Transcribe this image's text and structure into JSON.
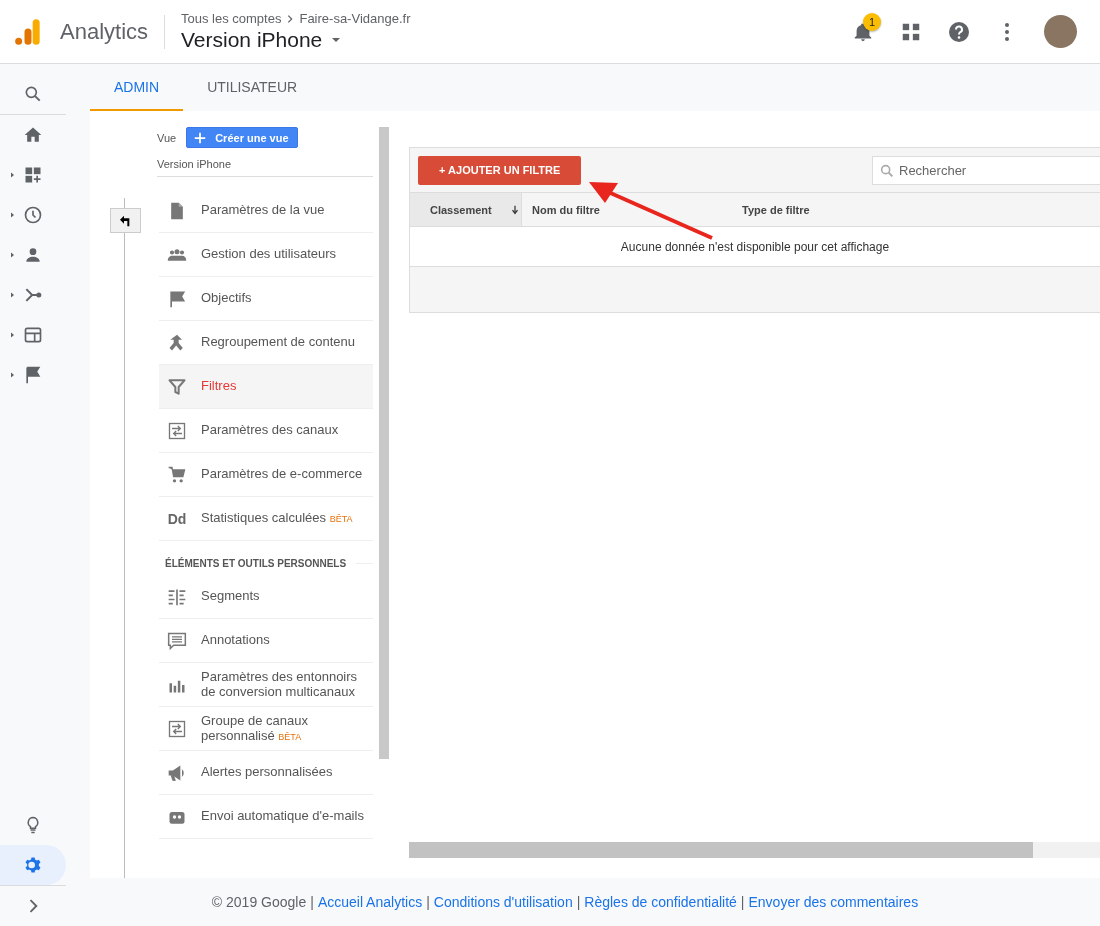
{
  "header": {
    "product": "Analytics",
    "breadcrumb": [
      "Tous les comptes",
      "Faire-sa-Vidange.fr"
    ],
    "view_name": "Version iPhone",
    "notification_count": "1"
  },
  "rail": {
    "items": [
      {
        "kind": "search",
        "expandable": false,
        "selected": false
      },
      {
        "kind": "home",
        "expandable": false,
        "selected": false
      },
      {
        "kind": "dashboard",
        "expandable": true,
        "selected": false
      },
      {
        "kind": "clock",
        "expandable": true,
        "selected": false
      },
      {
        "kind": "person",
        "expandable": true,
        "selected": false
      },
      {
        "kind": "branch",
        "expandable": true,
        "selected": false
      },
      {
        "kind": "layout",
        "expandable": true,
        "selected": false
      },
      {
        "kind": "flag",
        "expandable": true,
        "selected": false
      }
    ],
    "bottom_items": [
      {
        "kind": "bulb",
        "selected": false
      },
      {
        "kind": "gear",
        "selected": true
      },
      {
        "kind": "chevron",
        "selected": false
      }
    ]
  },
  "tabs": [
    {
      "label": "ADMIN",
      "selected": true
    },
    {
      "label": "UTILISATEUR",
      "selected": false
    }
  ],
  "view_panel": {
    "label": "Vue",
    "create_button": "Créer une vue",
    "current_view": "Version iPhone",
    "items": [
      {
        "kind": "item",
        "label": "Paramètres de la vue",
        "selected": false
      },
      {
        "kind": "item",
        "label": "Gestion des utilisateurs",
        "selected": false
      },
      {
        "kind": "item",
        "label": "Objectifs",
        "selected": false
      },
      {
        "kind": "item",
        "label": "Regroupement de contenu",
        "selected": false
      },
      {
        "kind": "item",
        "label": "Filtres",
        "selected": true
      },
      {
        "kind": "item",
        "label": "Paramètres des canaux",
        "selected": false
      },
      {
        "kind": "item",
        "label": "Paramètres de e-commerce",
        "selected": false
      },
      {
        "kind": "item",
        "icon_text": "Dd",
        "label": "Statistiques calculées",
        "badge": "BÊTA",
        "selected": false
      },
      {
        "kind": "section",
        "label": "ÉLÉMENTS ET OUTILS PERSONNELS"
      },
      {
        "kind": "item",
        "label": "Segments",
        "selected": false
      },
      {
        "kind": "item",
        "label": "Annotations",
        "selected": false
      },
      {
        "kind": "item",
        "label": "Paramètres des entonnoirs de conversion multicanaux",
        "selected": false
      },
      {
        "kind": "item",
        "label": "Groupe de canaux personnalisé",
        "badge": "BÊTA",
        "selected": false
      },
      {
        "kind": "item",
        "label": "Alertes personnalisées",
        "selected": false
      },
      {
        "kind": "item",
        "label": "Envoi automatique d'e-mails",
        "selected": false
      }
    ]
  },
  "filters": {
    "add_button": "+ AJOUTER UN FILTRE",
    "search": {
      "placeholder": "Rechercher"
    },
    "columns": [
      {
        "label": "Classement",
        "sorted": true
      },
      {
        "label": "Nom du filtre",
        "sorted": false
      },
      {
        "label": "Type de filtre",
        "sorted": false
      }
    ],
    "empty_message": "Aucune donnée n'est disponible pour cet affichage"
  },
  "footer": {
    "items": [
      {
        "kind": "text",
        "text": "© 2019 Google"
      },
      {
        "kind": "separator",
        "text": "|"
      },
      {
        "kind": "link",
        "text": "Accueil Analytics"
      },
      {
        "kind": "separator",
        "text": "|"
      },
      {
        "kind": "link",
        "text": "Conditions d'utilisation"
      },
      {
        "kind": "separator",
        "text": "|"
      },
      {
        "kind": "link",
        "text": "Règles de confidentialité"
      },
      {
        "kind": "separator",
        "text": "|"
      },
      {
        "kind": "link",
        "text": "Envoyer des commentaires"
      }
    ]
  }
}
